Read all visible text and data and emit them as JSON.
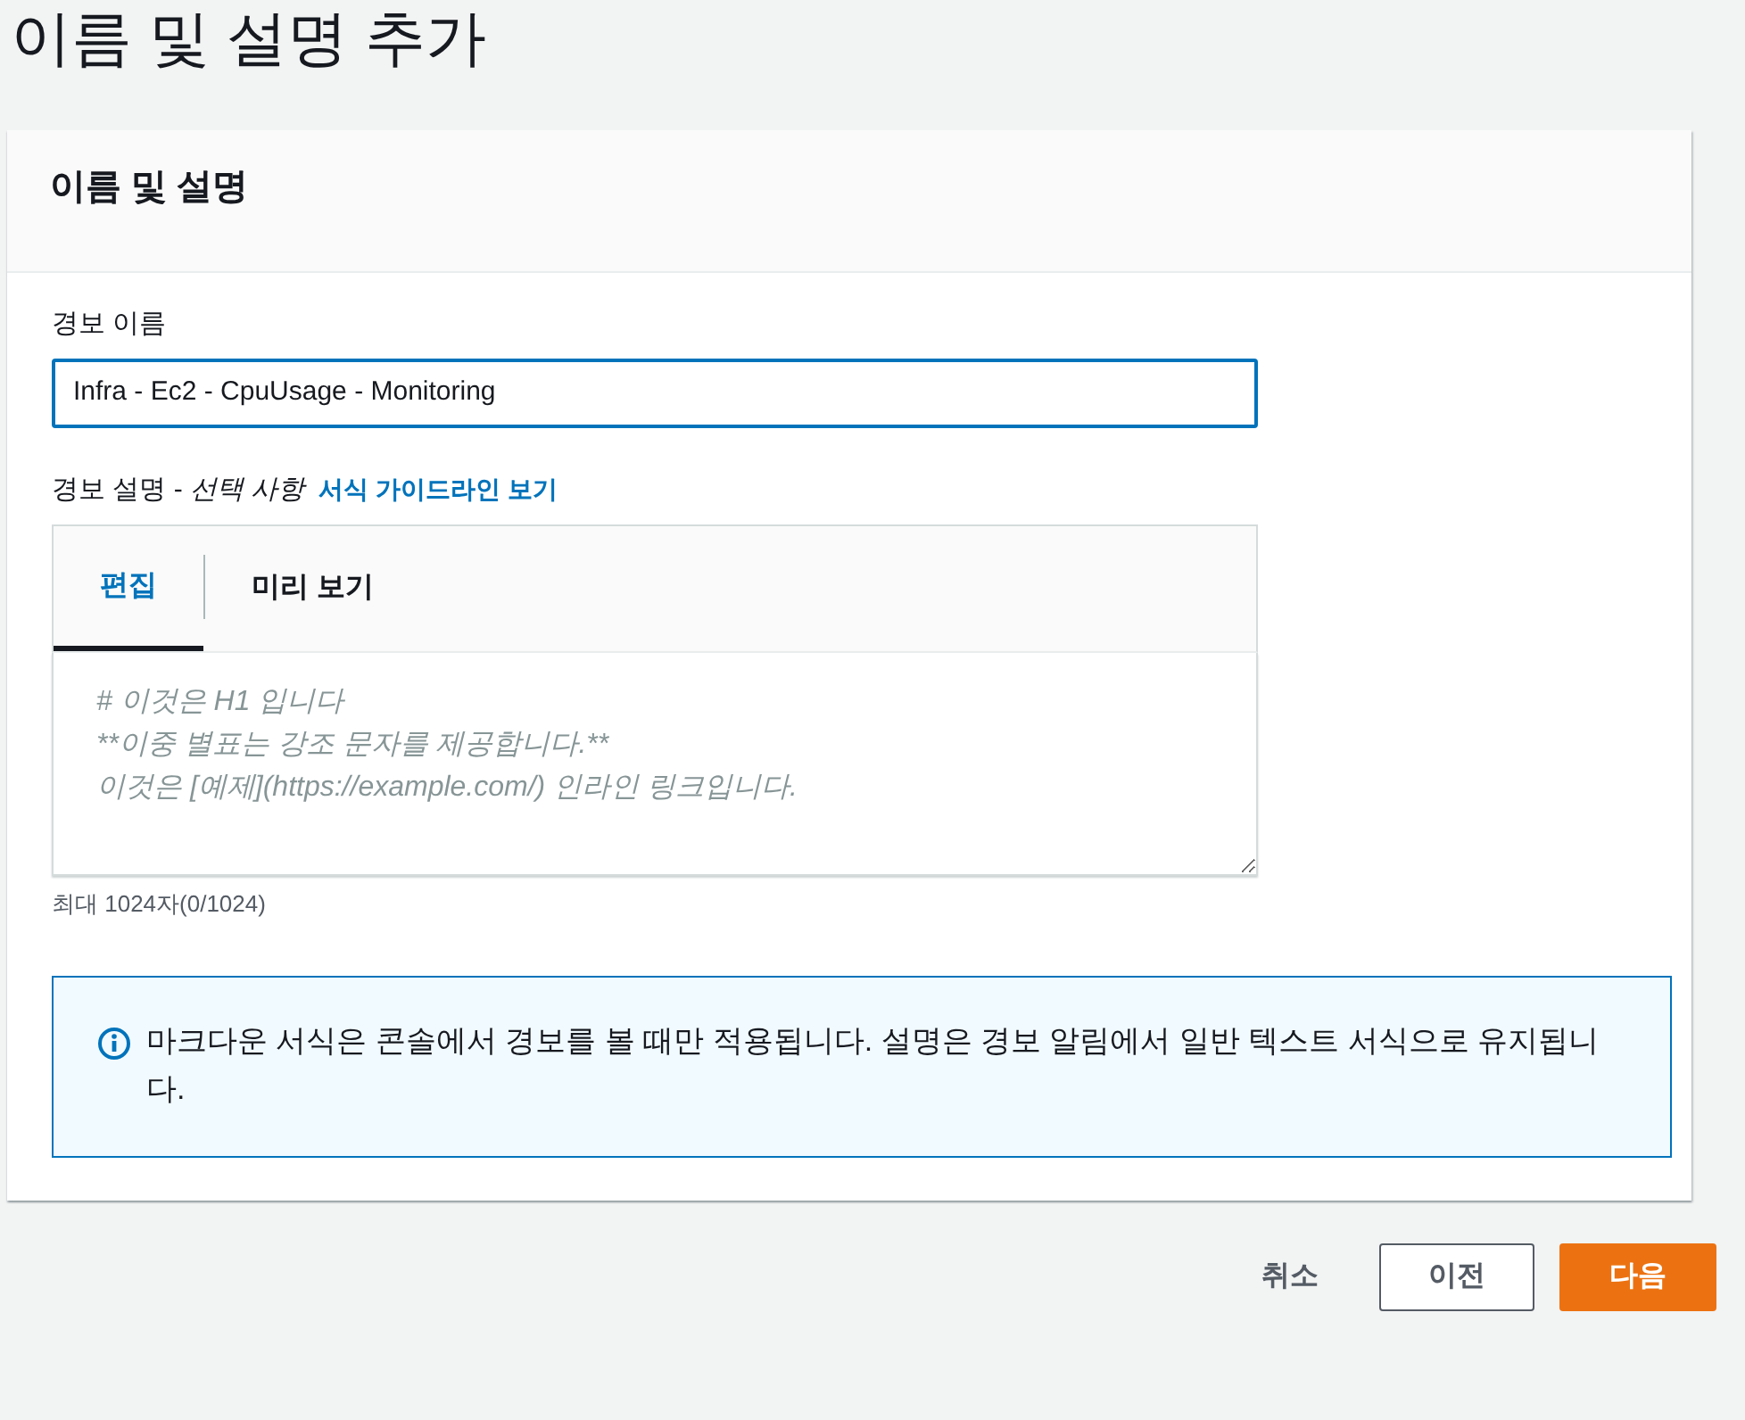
{
  "page_title": "이름 및 설명 추가",
  "panel": {
    "title": "이름 및 설명",
    "name_field": {
      "label": "경보 이름",
      "value": "Infra - Ec2 - CpuUsage - Monitoring"
    },
    "description_field": {
      "label": "경보 설명 - *선택 사항*",
      "link": "서식 가이드라인 보기",
      "tabs": [
        {
          "label": "편집",
          "selected": true
        },
        {
          "label": "미리 보기",
          "selected": false
        }
      ],
      "placeholder": "# 이것은 H1 입니다\n**이중 별표는 강조 문자를 제공합니다.**\n이것은 [예제](https://example.com/) 인라인 링크입니다.",
      "hint": "최대 1024자(0/1024)"
    },
    "info": "마크다운 서식은 콘솔에서 경보를 볼 때만 적용됩니다. 설명은 경보 알림에서 일반 텍스트 서식으로 유지됩니다."
  },
  "buttons": [
    {
      "label": "취소",
      "kind": "link"
    },
    {
      "label": "이전",
      "kind": "secondary"
    },
    {
      "label": "다음",
      "kind": "primary"
    }
  ]
}
